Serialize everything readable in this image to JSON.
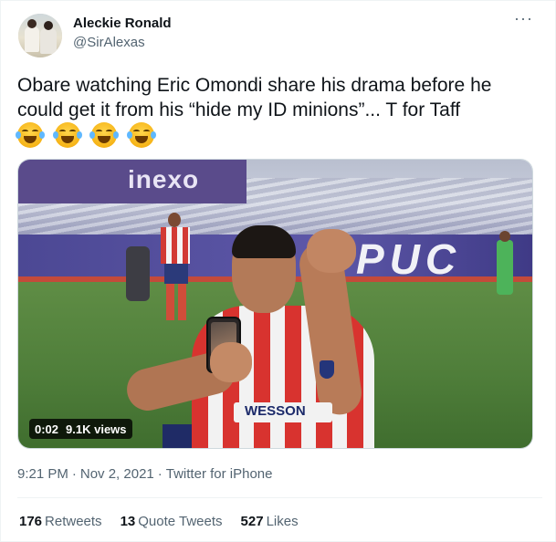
{
  "author": {
    "name": "Aleckie Ronald",
    "handle": "@SirAlexas",
    "avatar_icon": "profile-photo-two-people"
  },
  "tweet": {
    "text": "Obare watching Eric Omondi share his drama before he could get it from his “hide my ID minions”... T for Taff",
    "emojis": [
      "😂",
      "😂",
      "😂",
      "😂"
    ],
    "emoji_icon": "face-with-tears-of-joy-icon"
  },
  "media": {
    "type": "video",
    "duration": "0:02",
    "views": "9.1K views",
    "banner_text": "inexo",
    "adboard_text": "PUC",
    "sponsor_text": "WESSON"
  },
  "meta": {
    "time": "9:21 PM",
    "date": "Nov 2, 2021",
    "source": "Twitter for iPhone"
  },
  "stats": {
    "retweets_count": "176",
    "retweets_label": "Retweets",
    "quotes_count": "13",
    "quotes_label": "Quote Tweets",
    "likes_count": "527",
    "likes_label": "Likes"
  },
  "colors": {
    "text_primary": "#0f1419",
    "text_secondary": "#536471",
    "divider": "#eff3f4"
  }
}
